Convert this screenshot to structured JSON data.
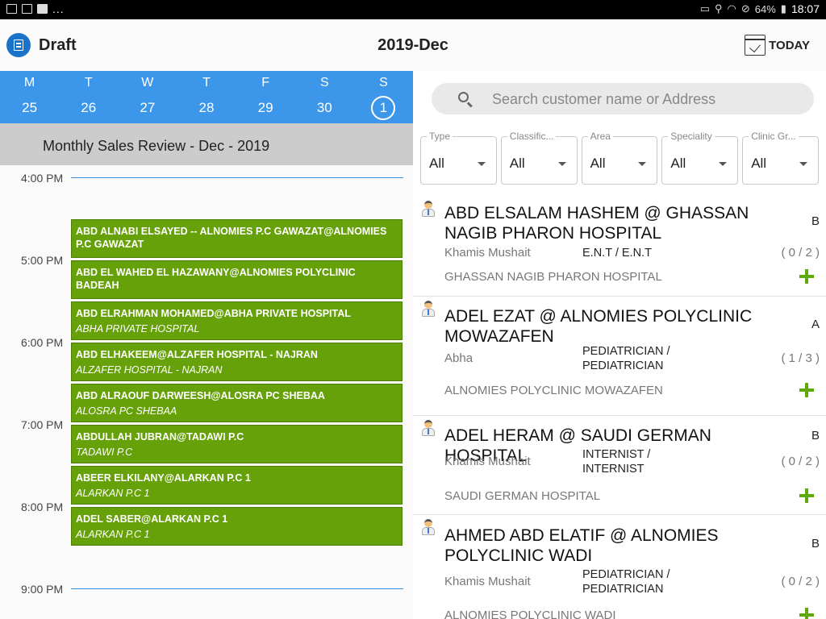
{
  "status_bar": {
    "battery": "64%",
    "clock": "18:07",
    "overflow": "..."
  },
  "header": {
    "title": "Draft",
    "month": "2019-Dec",
    "today_label": "TODAY"
  },
  "week": [
    {
      "dow": "M",
      "date": "25"
    },
    {
      "dow": "T",
      "date": "26"
    },
    {
      "dow": "W",
      "date": "27"
    },
    {
      "dow": "T",
      "date": "28"
    },
    {
      "dow": "F",
      "date": "29"
    },
    {
      "dow": "S",
      "date": "30"
    },
    {
      "dow": "S",
      "date": "1",
      "selected": true
    }
  ],
  "review_banner": "Monthly Sales Review - Dec - 2019",
  "timeline": {
    "times": [
      "4:00 PM",
      "5:00 PM",
      "6:00 PM",
      "7:00 PM",
      "8:00 PM",
      "9:00 PM"
    ],
    "events": [
      {
        "title": "ABD ALNABI ELSAYED -- ALNOMIES P.C GAWAZAT@ALNOMIES P.C GAWAZAT",
        "subtitle": ""
      },
      {
        "title": "ABD EL WAHED EL HAZAWANY@ALNOMIES POLYCLINIC BADEAH",
        "subtitle": ""
      },
      {
        "title": "ABD ELRAHMAN MOHAMED@ABHA PRIVATE HOSPITAL",
        "subtitle": "ABHA PRIVATE HOSPITAL"
      },
      {
        "title": "ABD ELHAKEEM@ALZAFER HOSPITAL - NAJRAN",
        "subtitle": "ALZAFER HOSPITAL - NAJRAN"
      },
      {
        "title": "ABD ALRAOUF DARWEESH@ALOSRA PC SHEBAA",
        "subtitle": "ALOSRA PC SHEBAA"
      },
      {
        "title": "ABDULLAH JUBRAN@TADAWI P.C",
        "subtitle": "TADAWI P.C"
      },
      {
        "title": "ABEER ELKILANY@ALARKAN P.C 1",
        "subtitle": "ALARKAN P.C 1"
      },
      {
        "title": "ADEL SABER@ALARKAN P.C 1",
        "subtitle": "ALARKAN P.C 1"
      }
    ]
  },
  "search": {
    "placeholder": "Search customer name or Address",
    "value": ""
  },
  "filters": [
    {
      "label": "Type",
      "value": "All"
    },
    {
      "label": "Classific...",
      "value": "All"
    },
    {
      "label": "Area",
      "value": "All"
    },
    {
      "label": "Speciality",
      "value": "All"
    },
    {
      "label": "Clinic Gr...",
      "value": "All"
    }
  ],
  "customers": [
    {
      "name": "ABD ELSALAM HASHEM @ GHASSAN NAGIB PHARON HOSPITAL",
      "grade": "B",
      "city": "Khamis Mushait",
      "speciality": "E.N.T / E.N.T",
      "visits": "( 0 / 2 )",
      "hospital": "GHASSAN NAGIB PHARON HOSPITAL"
    },
    {
      "name": "ADEL EZAT @ ALNOMIES POLYCLINIC MOWAZAFEN",
      "grade": "A",
      "city": "Abha",
      "speciality": "PEDIATRICIAN / PEDIATRICIAN",
      "visits": "( 1 / 3 )",
      "hospital": "ALNOMIES POLYCLINIC MOWAZAFEN"
    },
    {
      "name": "ADEL HERAM @ SAUDI GERMAN HOSPITAL",
      "grade": "B",
      "city": "Khamis Mushait",
      "speciality": "INTERNIST / INTERNIST",
      "visits": "( 0 / 2 )",
      "hospital": "SAUDI GERMAN HOSPITAL"
    },
    {
      "name": "AHMED ABD ELATIF @ ALNOMIES POLYCLINIC WADI",
      "grade": "B",
      "city": "Khamis Mushait",
      "speciality": "PEDIATRICIAN / PEDIATRICIAN",
      "visits": "( 0 / 2 )",
      "hospital": "ALNOMIES POLYCLINIC WADI"
    }
  ],
  "colors": {
    "week_strip": "#3c97ea",
    "event_green": "#66a10a",
    "add_green": "#5ea80a",
    "draft_icon": "#1a73c8"
  }
}
